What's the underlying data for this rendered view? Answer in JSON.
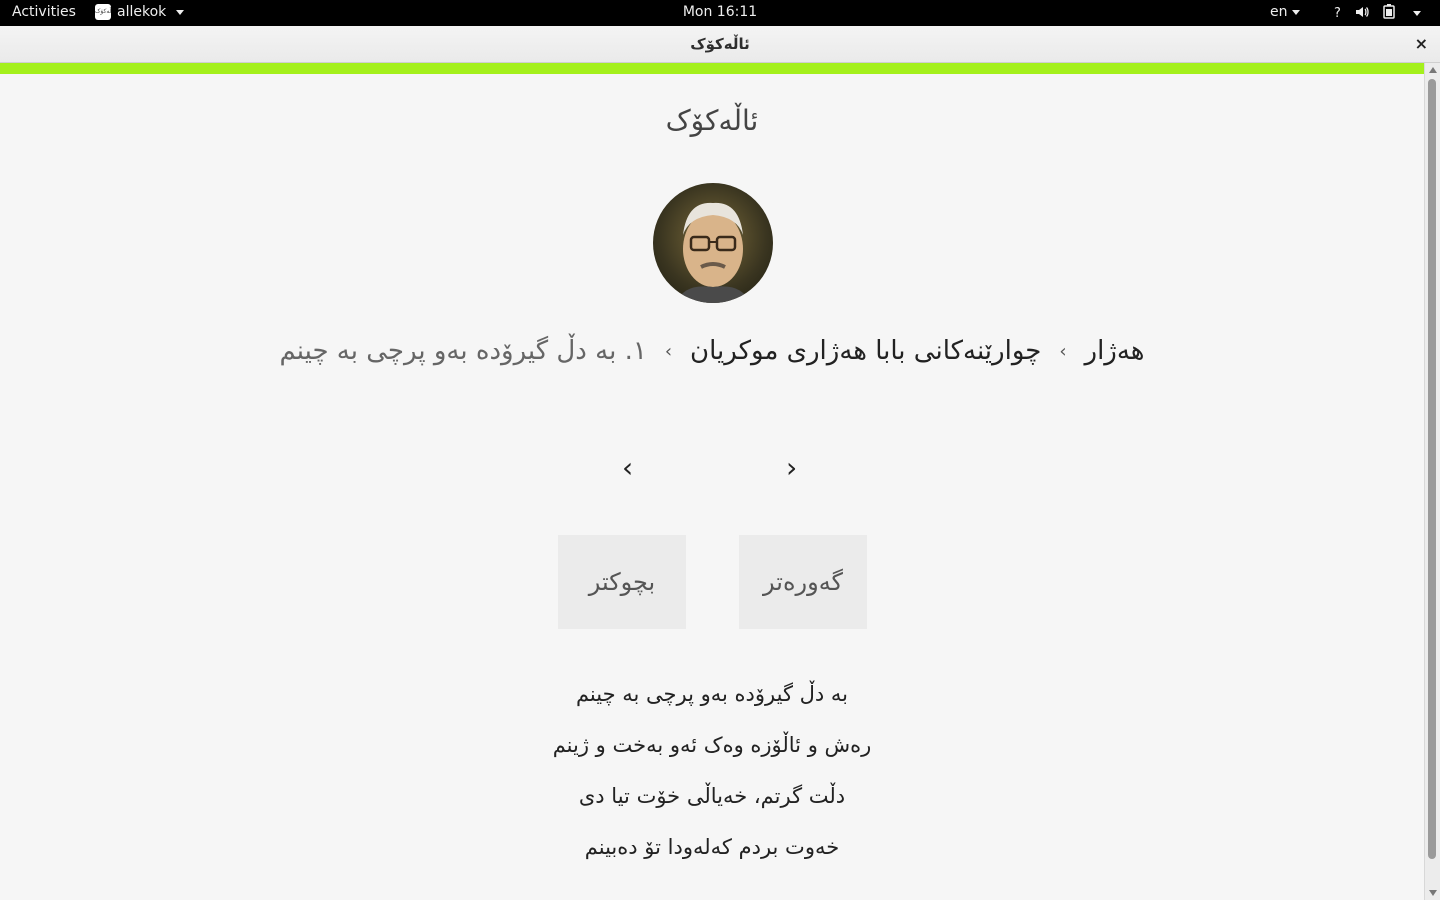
{
  "topbar": {
    "activities": "Activities",
    "app_name": "allekok",
    "app_icon_text": "ئاڵەکۆک",
    "clock": "Mon 16:11",
    "lang": "en",
    "help_icon": "?"
  },
  "window": {
    "title": "ئاڵەکۆک",
    "close": "×"
  },
  "progress": {
    "value": 1.0,
    "color": "#a4f01c"
  },
  "app": {
    "title": "ئاڵەکۆک"
  },
  "breadcrumb": {
    "poet": "هەژار",
    "book": "چوارێنەکانی بابا هەژاری موکریان",
    "poem": "١. بە دڵ گیرۆدە بەو پرچی بە چینم",
    "separator": "›"
  },
  "nav": {
    "prev": "›",
    "next": "‹"
  },
  "buttons": {
    "larger": "گەورەتر",
    "smaller": "بچوکتر"
  },
  "poem": {
    "lines": [
      "بە دڵ گیرۆدە بەو پرچی بە چینم",
      "رەش و ئاڵۆزە وەک ئەو بەخت و ژینم",
      "دڵت گرتم، خەیاڵی خۆت تیا دی",
      "خەوت بردم کەلەودا تۆ دەبینم"
    ]
  },
  "colors": {
    "topbar_bg": "#000000",
    "background": "#f6f6f6",
    "accent": "#a4f01c"
  }
}
